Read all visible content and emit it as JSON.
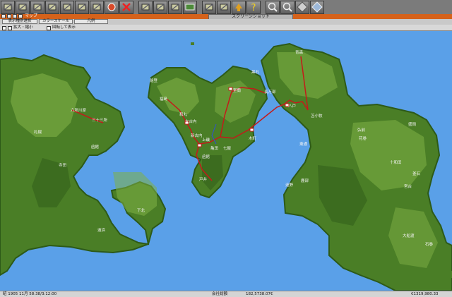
{
  "toolbar": {
    "buttons": [
      {
        "name": "menu-icon"
      },
      {
        "name": "map-icon"
      },
      {
        "name": "terrain-icon"
      },
      {
        "name": "road-icon"
      },
      {
        "name": "rail-icon"
      },
      {
        "name": "train-icon"
      },
      {
        "name": "bus-icon"
      },
      {
        "name": "station-icon"
      },
      {
        "name": "demolish-icon"
      },
      {
        "name": "report-icon"
      },
      {
        "name": "schedule-icon"
      },
      {
        "name": "finance-icon"
      },
      {
        "name": "money-icon"
      },
      {
        "name": "company-icon"
      },
      {
        "name": "view-icon"
      },
      {
        "name": "info-icon"
      },
      {
        "name": "help-icon"
      },
      {
        "name": "zoom-in-icon"
      },
      {
        "name": "zoom-out-icon"
      },
      {
        "name": "rotate-icon"
      },
      {
        "name": "compass-icon"
      }
    ]
  },
  "window": {
    "title": "マップ",
    "screenshot_label": "スクリーンショット"
  },
  "tabs": [
    {
      "label": "表示種別選択"
    },
    {
      "label": "カラースケール"
    },
    {
      "label": "凡例"
    }
  ],
  "controls": {
    "zoom_label": "拡大・縮小",
    "rotate_label": "回転して表示"
  },
  "map_labels": [
    {
      "text": "札幌"
    },
    {
      "text": "六所川原"
    },
    {
      "text": "三十三所"
    },
    {
      "text": "函館"
    },
    {
      "text": "寺田"
    },
    {
      "text": "遠浜"
    },
    {
      "text": "下北"
    },
    {
      "text": "能登"
    },
    {
      "text": "福島"
    },
    {
      "text": "和丸"
    },
    {
      "text": "大古内"
    },
    {
      "text": "新古内"
    },
    {
      "text": "上磯"
    },
    {
      "text": "亀田"
    },
    {
      "text": "七飯"
    },
    {
      "text": "函館"
    },
    {
      "text": "戸井"
    },
    {
      "text": "長万部"
    },
    {
      "text": "黒石"
    },
    {
      "text": "室蘭"
    },
    {
      "text": "木町"
    },
    {
      "text": "苫小牧"
    },
    {
      "text": "青森"
    },
    {
      "text": "八戸"
    },
    {
      "text": "東通"
    },
    {
      "text": "鹿部"
    },
    {
      "text": "弘前"
    },
    {
      "text": "十和田"
    },
    {
      "text": "盛岡"
    },
    {
      "text": "花巻"
    },
    {
      "text": "石巻"
    },
    {
      "text": "宮古"
    },
    {
      "text": "大船渡"
    },
    {
      "text": "釜石"
    },
    {
      "text": "遠野"
    }
  ],
  "status": {
    "date": "昭 1905 11月 58:38/3:12:00",
    "center_label": "会社総額",
    "cash": "182,5738.07€",
    "funds": "€1319,980.33"
  },
  "colors": {
    "sea": "#5aa0e8",
    "land_dark": "#2d5a18",
    "land_mid": "#4a7e26",
    "land_light": "#80b046",
    "rail": "#c41a1a",
    "toolbar": "#7b7b7b",
    "titlebar": "#d5621b"
  }
}
